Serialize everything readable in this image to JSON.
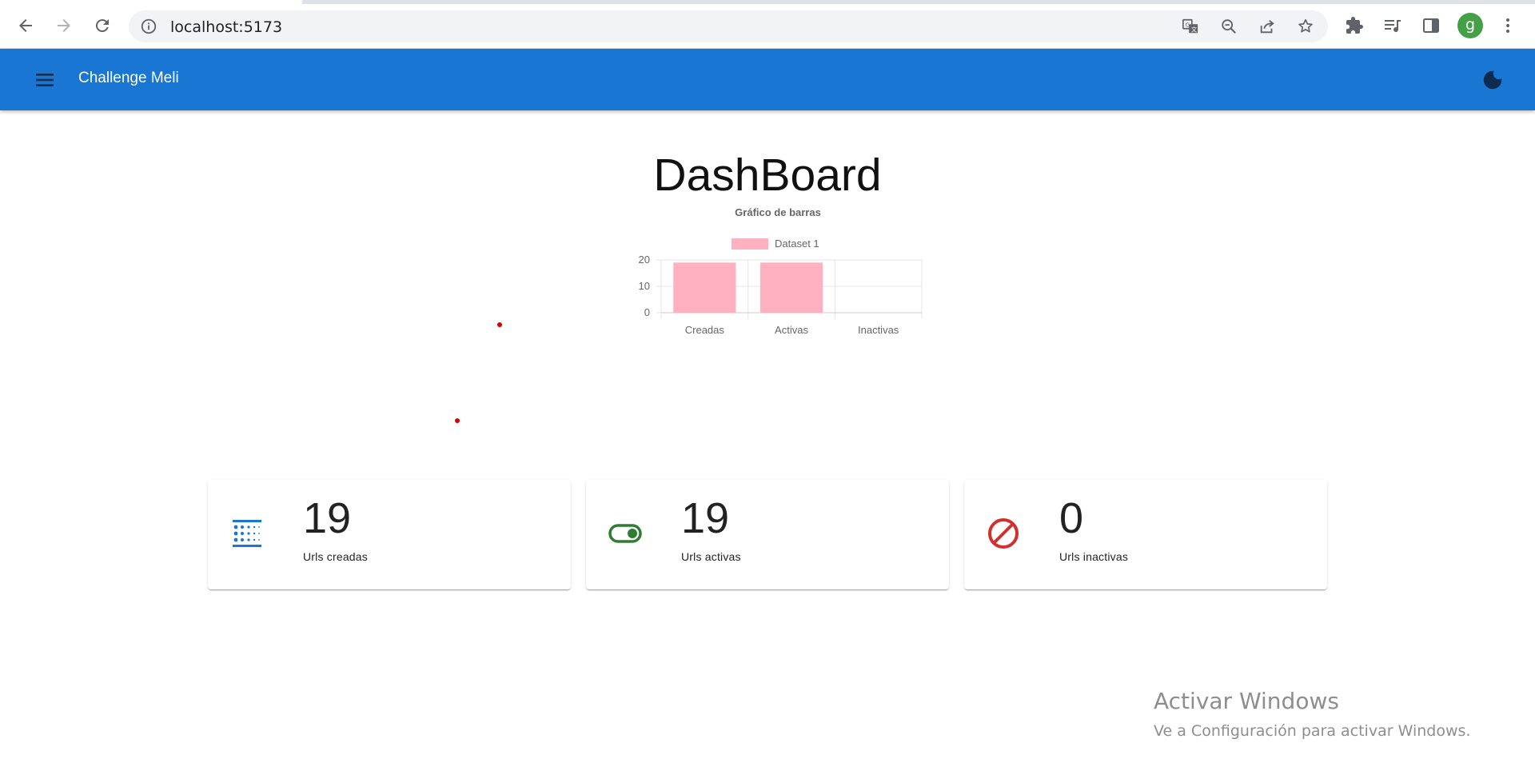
{
  "browser": {
    "url": "localhost:5173",
    "profile_initial": "g",
    "icons": [
      "back-icon",
      "forward-icon",
      "reload-icon",
      "info-icon",
      "translate-icon",
      "zoom-out-icon",
      "share-icon",
      "star-icon",
      "extensions-icon",
      "media-icon",
      "side-panel-icon",
      "more-icon"
    ]
  },
  "appbar": {
    "title": "Challenge Meli",
    "menu_icon": "menu-icon",
    "theme_icon": "dark-mode-icon",
    "color": "#1976d2"
  },
  "dashboard": {
    "title": "DashBoard",
    "cards": [
      {
        "value": "19",
        "label": "Urls creadas",
        "icon": "list-dots-icon",
        "icon_color": "#1976d2"
      },
      {
        "value": "19",
        "label": "Urls activas",
        "icon": "toggle-on-icon",
        "icon_color": "#2e7d32"
      },
      {
        "value": "0",
        "label": "Urls inactivas",
        "icon": "block-icon",
        "icon_color": "#d32f2f"
      }
    ]
  },
  "chart_data": {
    "type": "bar",
    "title": "Gráfico de barras",
    "categories": [
      "Creadas",
      "Activas",
      "Inactivas"
    ],
    "series": [
      {
        "name": "Dataset 1",
        "values": [
          19,
          19,
          0
        ],
        "color": "#ffb1c1",
        "border_color": "#ff6384"
      }
    ],
    "yticks": [
      0,
      10,
      20
    ],
    "ylim": [
      0,
      20
    ],
    "grid": true,
    "legend": "top"
  },
  "watermark": {
    "title": "Activar Windows",
    "subtitle": "Ve a Configuración para activar Windows."
  }
}
